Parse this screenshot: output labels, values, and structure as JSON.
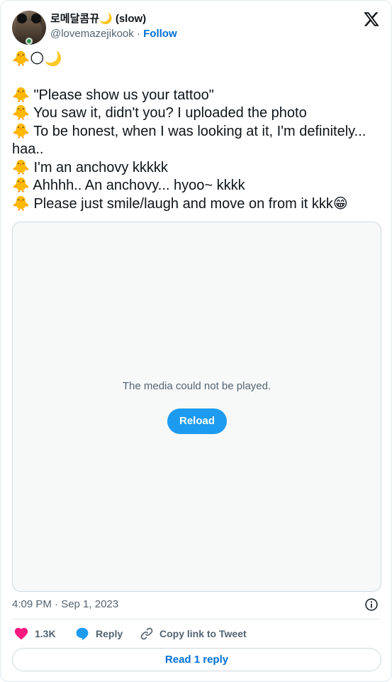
{
  "header": {
    "display_name": "로메달콤뀨🌙 (slow)",
    "handle": "@lovemazejikook",
    "separator": " · ",
    "follow_label": "Follow"
  },
  "tweet": {
    "emoji_line": "🐥🌕🌙",
    "lines": [
      "🐥 \"Please show us your tattoo\"",
      "🐥 You saw it, didn't you? I uploaded the photo",
      "🐥 To be honest, when I was looking at it, I'm definitely... haa..",
      "🐥 I'm an anchovy kkkkk",
      "🐥 Ahhhh.. An anchovy... hyoo~ kkkk",
      "🐥 Please just smile/laugh and move on from it kkk😁"
    ]
  },
  "media": {
    "message": "The media could not be played.",
    "reload_label": "Reload"
  },
  "meta": {
    "timestamp": "4:09 PM · Sep 1, 2023"
  },
  "actions": {
    "like_count": "1.3K",
    "reply_label": "Reply",
    "copy_label": "Copy link to Tweet"
  },
  "footer": {
    "read_replies_label": "Read 1 reply"
  },
  "colors": {
    "accent": "#1d9bf0",
    "link": "#006fd6",
    "like": "#f91880",
    "muted": "#536471"
  }
}
